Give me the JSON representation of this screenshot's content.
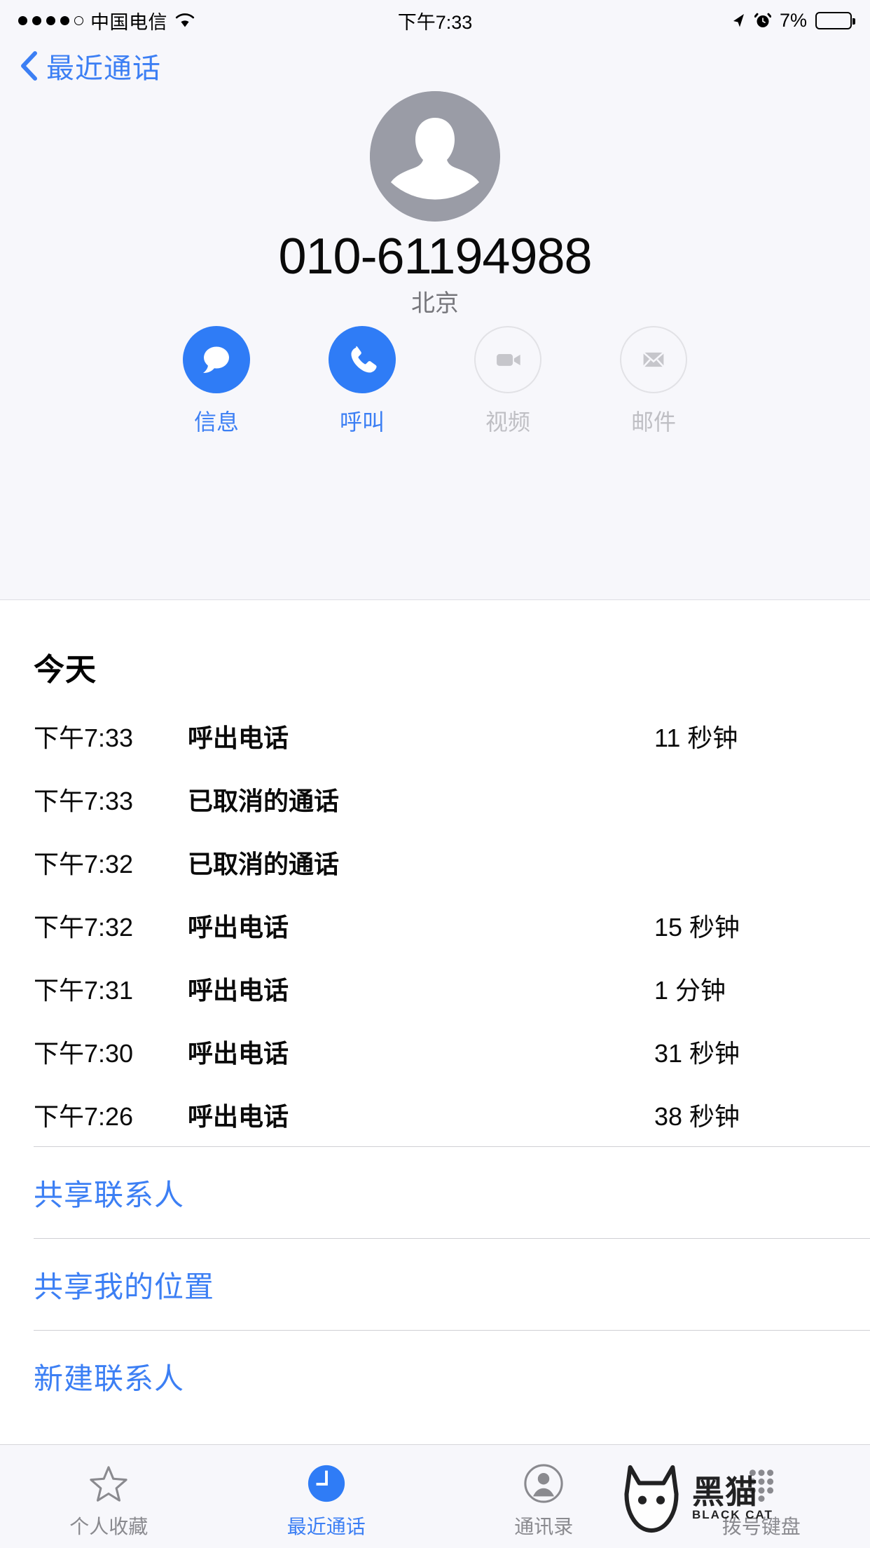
{
  "status_bar": {
    "signal_dots_filled": 4,
    "signal_dots_total": 5,
    "carrier": "中国电信",
    "wifi_icon": "wifi-icon",
    "time": "下午7:33",
    "location_icon": "location-arrow-icon",
    "alarm_icon": "alarm-clock-icon",
    "battery_percent": "7%",
    "battery_fill_ratio": 0.14,
    "battery_color": "#FFCC00"
  },
  "nav": {
    "back_icon": "chevron-left-icon",
    "back_label": "最近通话"
  },
  "contact": {
    "avatar_icon": "person-placeholder-icon",
    "phone_number": "010-61194988",
    "location": "北京"
  },
  "actions": [
    {
      "key": "message",
      "icon": "message-bubble-icon",
      "label": "信息",
      "enabled": true
    },
    {
      "key": "call",
      "icon": "phone-handset-icon",
      "label": "呼叫",
      "enabled": true
    },
    {
      "key": "video",
      "icon": "video-camera-icon",
      "label": "视频",
      "enabled": false
    },
    {
      "key": "mail",
      "icon": "envelope-icon",
      "label": "邮件",
      "enabled": false
    }
  ],
  "call_log": {
    "day_header": "今天",
    "rows": [
      {
        "time": "下午7:33",
        "type": "呼出电话",
        "duration": "11 秒钟"
      },
      {
        "time": "下午7:33",
        "type": "已取消的通话",
        "duration": ""
      },
      {
        "time": "下午7:32",
        "type": "已取消的通话",
        "duration": ""
      },
      {
        "time": "下午7:32",
        "type": "呼出电话",
        "duration": "15 秒钟"
      },
      {
        "time": "下午7:31",
        "type": "呼出电话",
        "duration": "1 分钟"
      },
      {
        "time": "下午7:30",
        "type": "呼出电话",
        "duration": "31 秒钟"
      },
      {
        "time": "下午7:26",
        "type": "呼出电话",
        "duration": "38 秒钟"
      }
    ]
  },
  "link_actions": [
    {
      "key": "share-contact",
      "label": "共享联系人"
    },
    {
      "key": "share-location",
      "label": "共享我的位置"
    },
    {
      "key": "new-contact",
      "label": "新建联系人"
    }
  ],
  "tab_bar": [
    {
      "key": "favorites",
      "icon": "star-icon",
      "label": "个人收藏",
      "active": false
    },
    {
      "key": "recents",
      "icon": "clock-icon",
      "label": "最近通话",
      "active": true
    },
    {
      "key": "contacts",
      "icon": "person-icon",
      "label": "通讯录",
      "active": false
    },
    {
      "key": "keypad",
      "icon": "keypad-icon",
      "label": "拨号键盘",
      "active": false
    }
  ],
  "watermark": {
    "text": "黑猫",
    "subtext": "BLACK CAT",
    "logo_icon": "black-cat-logo-icon"
  },
  "colors": {
    "accent_blue": "#3C7FF4",
    "button_blue": "#2F7CF6",
    "header_bg": "#F7F7FB",
    "disabled_gray": "#BFBFC4"
  }
}
